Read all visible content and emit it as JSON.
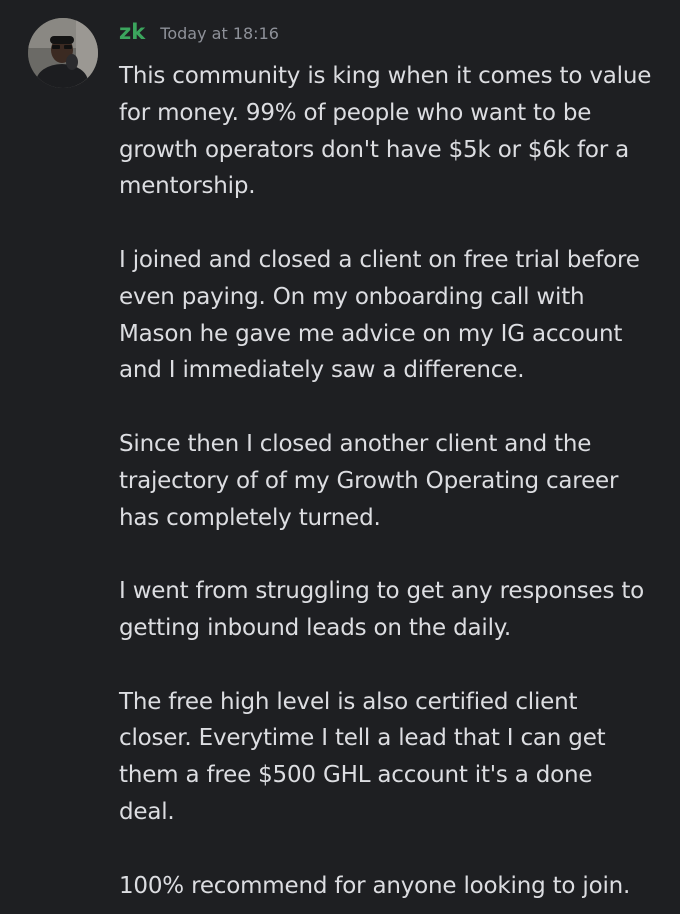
{
  "message": {
    "author": "zk",
    "timestamp": "Today at 18:16",
    "author_color": "#3ba55d",
    "avatar_icon": "user-avatar-icon",
    "paragraphs": [
      {
        "lines": [
          "This community is king when it comes to value",
          "for money. 99% of people who want to be",
          "growth operators don't have $5k or $6k for a",
          "mentorship."
        ]
      },
      {
        "lines": [
          "I joined and closed a client on free trial before",
          "even paying. On my onboarding call with",
          "Mason he gave me advice on my IG account",
          "and I immediately saw a difference."
        ]
      },
      {
        "lines": [
          "Since then I closed another client and the",
          "trajectory of of my Growth Operating career",
          "has completely turned."
        ]
      },
      {
        "lines": [
          "I went from struggling to get any responses to",
          "getting inbound leads on the daily."
        ]
      },
      {
        "lines": [
          "The free high level is also certified client",
          "closer. Everytime I tell a lead that I can get",
          "them a free $500 GHL account it's a done",
          "deal."
        ]
      },
      {
        "lines": [
          "100% recommend for anyone looking to join."
        ]
      }
    ]
  }
}
